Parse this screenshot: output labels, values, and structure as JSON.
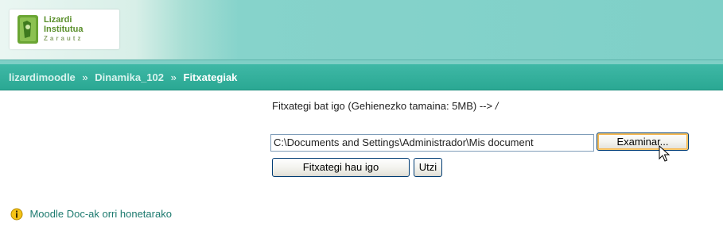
{
  "header": {
    "logo": {
      "line1": "Lizardi",
      "line2": "Institutua",
      "line3": "Zarautz"
    }
  },
  "breadcrumb": {
    "items": [
      "lizardimoodle",
      "Dinamika_102"
    ],
    "separator": "»",
    "current": "Fitxategiak"
  },
  "upload": {
    "info_text": "Fitxategi bat igo (Gehienezko tamaina: 5MB) --> ",
    "info_path": "/",
    "file_value": "C:\\Documents and Settings\\Administrador\\Mis document",
    "browse_label": "Examinar...",
    "upload_label": "Fitxategi hau igo",
    "cancel_label": "Utzi"
  },
  "help": {
    "icon": "info-icon",
    "link_text": "Moodle Doc-ak orri honetarako"
  },
  "colors": {
    "header_teal": "#7fd0c8",
    "breadcrumb_teal": "#2aa893",
    "link_green": "#1d7a6f",
    "logo_green": "#5a8f2b"
  }
}
